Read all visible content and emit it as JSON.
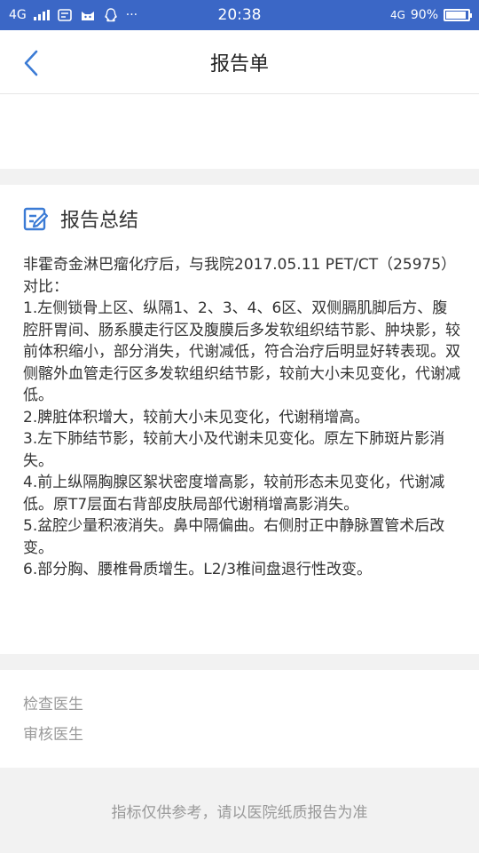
{
  "status_bar": {
    "network_left": "4G",
    "time": "20:38",
    "network_right": "4G",
    "battery": "90%",
    "battery_level": 0.9
  },
  "nav": {
    "title": "报告单"
  },
  "summary": {
    "title": "报告总结",
    "lines": [
      "非霍奇金淋巴瘤化疗后，与我院2017.05.11 PET/CT（25975）对比：",
      "1.左侧锁骨上区、纵隔1、2、3、4、6区、双侧膈肌脚后方、腹腔肝胃间、肠系膜走行区及腹膜后多发软组织结节影、肿块影，较前体积缩小，部分消失，代谢减低，符合治疗后明显好转表现。双侧髂外血管走行区多发软组织结节影，较前大小未见变化，代谢减低。",
      "2.脾脏体积增大，较前大小未见变化，代谢稍增高。",
      "3.左下肺结节影，较前大小及代谢未见变化。原左下肺斑片影消失。",
      "4.前上纵隔胸腺区絮状密度增高影，较前形态未见变化，代谢减低。原T7层面右背部皮肤局部代谢稍增高影消失。",
      "5.盆腔少量积液消失。鼻中隔偏曲。右侧肘正中静脉置管术后改变。",
      "6.部分胸、腰椎骨质增生。L2/3椎间盘退行性改变。"
    ]
  },
  "doctors": {
    "examining_label": "检查医生",
    "reviewing_label": "审核医生"
  },
  "footer": {
    "note": "指标仅供参考，请以医院纸质报告为准"
  },
  "colors": {
    "status_bar": "#3b67c6",
    "accent": "#3b7bd5"
  }
}
